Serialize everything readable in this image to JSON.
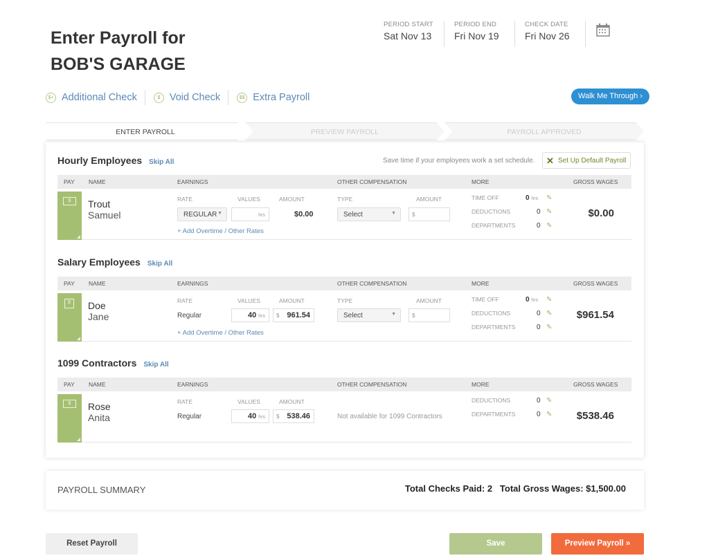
{
  "header": {
    "title_line1": "Enter Payroll for",
    "title_line2": "BOB'S GARAGE"
  },
  "dates": [
    {
      "label": "PERIOD START",
      "value": "Sat Nov 13"
    },
    {
      "label": "PERIOD END",
      "value": "Fri Nov 19"
    },
    {
      "label": "CHECK DATE",
      "value": "Fri Nov 26"
    }
  ],
  "actions": [
    {
      "label": "Additional Check",
      "icon": "$+"
    },
    {
      "label": "Void Check",
      "icon": "$"
    },
    {
      "label": "Extra Payroll",
      "icon": "$$"
    }
  ],
  "walk_me_through": "Walk Me Through ›",
  "steps": [
    "ENTER PAYROLL",
    "PREVIEW PAYROLL",
    "PAYROLL APPROVED"
  ],
  "hint": "Save time if your employees work a set schedule.",
  "setup_default": "Set Up Default Payroll",
  "skip_all": "Skip All",
  "columns": {
    "pay": "PAY",
    "name": "NAME",
    "earnings": "EARNINGS",
    "other": "OTHER COMPENSATION",
    "more": "MORE",
    "gross": "GROSS WAGES"
  },
  "subcols": {
    "rate": "RATE",
    "values": "VALUES",
    "amount": "AMOUNT",
    "type": "TYPE"
  },
  "more_labels": {
    "time_off": "TIME OFF",
    "deductions": "DEDUCTIONS",
    "departments": "DEPARTMENTS"
  },
  "add_overtime": "+ Add Overtime / Other Rates",
  "hrs": "hrs",
  "dollar": "$",
  "select_placeholder": "Select",
  "sections": {
    "hourly": {
      "title": "Hourly Employees",
      "last": "Trout",
      "first": "Samuel",
      "rate": "REGULAR",
      "values": "",
      "amount": "$0.00",
      "time_off": "0",
      "deductions": "0",
      "departments": "0",
      "gross": "$0.00"
    },
    "salary": {
      "title": "Salary Employees",
      "last": "Doe",
      "first": "Jane",
      "rate": "Regular",
      "values": "40",
      "amount": "961.54",
      "time_off": "0",
      "deductions": "0",
      "departments": "0",
      "gross": "$961.54"
    },
    "contractors": {
      "title": "1099 Contractors",
      "last": "Rose",
      "first": "Anita",
      "rate": "Regular",
      "values": "40",
      "amount": "538.46",
      "other_na": "Not available for 1099 Contractors",
      "deductions": "0",
      "departments": "0",
      "gross": "$538.46"
    }
  },
  "summary": {
    "label": "PAYROLL SUMMARY",
    "totals": "Total Checks Paid: 2   Total Gross Wages: $1,500.00"
  },
  "buttons": {
    "reset": "Reset Payroll",
    "save": "Save",
    "preview": "Preview Payroll »"
  }
}
